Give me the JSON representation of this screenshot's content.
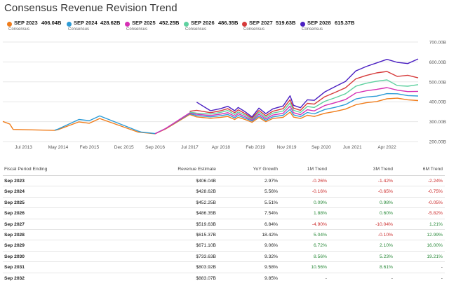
{
  "title": "Consensus Revenue Revision Trend",
  "legend": [
    {
      "name": "SEP 2023",
      "value": "406.04B",
      "sub": "Consensus",
      "color": "#f07c1a"
    },
    {
      "name": "SEP 2024",
      "value": "428.62B",
      "sub": "Consensus",
      "color": "#2d9bd6"
    },
    {
      "name": "SEP 2025",
      "value": "452.25B",
      "sub": "Consensus",
      "color": "#d62fb4"
    },
    {
      "name": "SEP 2026",
      "value": "486.35B",
      "sub": "Consensus",
      "color": "#5fd1a0"
    },
    {
      "name": "SEP 2027",
      "value": "519.63B",
      "sub": "Consensus",
      "color": "#d63a3a"
    },
    {
      "name": "SEP 2028",
      "value": "615.37B",
      "sub": "Consensus",
      "color": "#4a1fc2"
    }
  ],
  "chart_data": {
    "type": "line",
    "title": "Consensus Revenue Revision Trend",
    "xlabel": "",
    "ylabel": "",
    "x_ticks": [
      "Jul 2013",
      "May 2014",
      "Feb 2015",
      "Dec 2015",
      "Sep 2016",
      "Jul 2017",
      "Apr 2018",
      "Feb 2019",
      "Nov 2019",
      "Sep 2020",
      "Jun 2021",
      "Apr 2022"
    ],
    "y_ticks": [
      "200.00B",
      "300.00B",
      "400.00B",
      "500.00B",
      "600.00B",
      "700.00B"
    ],
    "ylim": [
      200,
      700
    ],
    "xlim": [
      "2013-01",
      "2023-01"
    ],
    "y_unit": "B",
    "grid": true,
    "legend_position": "top",
    "series": [
      {
        "name": "SEP 2023",
        "color": "#f07c1a",
        "points": [
          [
            "2013-01",
            301
          ],
          [
            "2013-03",
            288
          ],
          [
            "2013-04",
            261
          ],
          [
            "2014-04",
            256
          ],
          [
            "2014-05",
            260
          ],
          [
            "2014-11",
            299
          ],
          [
            "2015-02",
            292
          ],
          [
            "2015-05",
            316
          ],
          [
            "2016-04",
            248
          ],
          [
            "2016-05",
            246
          ],
          [
            "2016-09",
            239
          ],
          [
            "2016-12",
            263
          ],
          [
            "2017-07",
            336
          ],
          [
            "2017-09",
            324
          ],
          [
            "2018-01",
            317
          ],
          [
            "2018-04",
            322
          ],
          [
            "2018-06",
            326
          ],
          [
            "2018-08",
            311
          ],
          [
            "2018-09",
            322
          ],
          [
            "2018-11",
            311
          ],
          [
            "2019-01",
            297
          ],
          [
            "2019-03",
            321
          ],
          [
            "2019-05",
            300
          ],
          [
            "2019-07",
            316
          ],
          [
            "2019-10",
            322
          ],
          [
            "2019-12",
            348
          ],
          [
            "2020-01",
            323
          ],
          [
            "2020-03",
            316
          ],
          [
            "2020-05",
            332
          ],
          [
            "2020-07",
            326
          ],
          [
            "2020-10",
            342
          ],
          [
            "2021-01",
            351
          ],
          [
            "2021-04",
            363
          ],
          [
            "2021-07",
            385
          ],
          [
            "2021-10",
            395
          ],
          [
            "2022-01",
            401
          ],
          [
            "2022-04",
            415
          ],
          [
            "2022-07",
            418
          ],
          [
            "2022-10",
            410
          ],
          [
            "2023-01",
            406
          ]
        ]
      },
      {
        "name": "SEP 2024",
        "color": "#2d9bd6",
        "points": [
          [
            "2014-04",
            257
          ],
          [
            "2014-05",
            263
          ],
          [
            "2014-11",
            311
          ],
          [
            "2015-02",
            305
          ],
          [
            "2015-05",
            329
          ],
          [
            "2016-04",
            253
          ],
          [
            "2016-05",
            248
          ],
          [
            "2016-09",
            240
          ],
          [
            "2016-12",
            265
          ],
          [
            "2017-07",
            340
          ],
          [
            "2017-09",
            331
          ],
          [
            "2018-01",
            324
          ],
          [
            "2018-04",
            330
          ],
          [
            "2018-06",
            336
          ],
          [
            "2018-08",
            319
          ],
          [
            "2018-09",
            331
          ],
          [
            "2018-11",
            318
          ],
          [
            "2019-01",
            303
          ],
          [
            "2019-03",
            329
          ],
          [
            "2019-05",
            307
          ],
          [
            "2019-07",
            324
          ],
          [
            "2019-10",
            332
          ],
          [
            "2019-12",
            362
          ],
          [
            "2020-01",
            334
          ],
          [
            "2020-03",
            325
          ],
          [
            "2020-05",
            346
          ],
          [
            "2020-07",
            339
          ],
          [
            "2020-10",
            361
          ],
          [
            "2021-01",
            372
          ],
          [
            "2021-04",
            386
          ],
          [
            "2021-07",
            414
          ],
          [
            "2021-10",
            424
          ],
          [
            "2022-01",
            428
          ],
          [
            "2022-04",
            441
          ],
          [
            "2022-07",
            440
          ],
          [
            "2022-10",
            431
          ],
          [
            "2023-01",
            429
          ]
        ]
      },
      {
        "name": "SEP 2025",
        "color": "#d62fb4",
        "points": [
          [
            "2016-09",
            239
          ],
          [
            "2016-12",
            265
          ],
          [
            "2017-07",
            344
          ],
          [
            "2017-09",
            337
          ],
          [
            "2018-01",
            331
          ],
          [
            "2018-04",
            338
          ],
          [
            "2018-06",
            345
          ],
          [
            "2018-08",
            327
          ],
          [
            "2018-09",
            340
          ],
          [
            "2018-11",
            325
          ],
          [
            "2019-01",
            308
          ],
          [
            "2019-03",
            338
          ],
          [
            "2019-05",
            314
          ],
          [
            "2019-07",
            333
          ],
          [
            "2019-10",
            342
          ],
          [
            "2019-12",
            378
          ],
          [
            "2020-01",
            345
          ],
          [
            "2020-03",
            335
          ],
          [
            "2020-05",
            360
          ],
          [
            "2020-07",
            354
          ],
          [
            "2020-10",
            381
          ],
          [
            "2021-01",
            395
          ],
          [
            "2021-04",
            411
          ],
          [
            "2021-07",
            444
          ],
          [
            "2021-10",
            455
          ],
          [
            "2022-01",
            462
          ],
          [
            "2022-04",
            471
          ],
          [
            "2022-07",
            458
          ],
          [
            "2022-10",
            451
          ],
          [
            "2023-01",
            452
          ]
        ]
      },
      {
        "name": "SEP 2026",
        "color": "#5fd1a0",
        "points": [
          [
            "2017-07",
            348
          ],
          [
            "2017-09",
            343
          ],
          [
            "2018-01",
            338
          ],
          [
            "2018-04",
            347
          ],
          [
            "2018-06",
            356
          ],
          [
            "2018-08",
            336
          ],
          [
            "2018-09",
            349
          ],
          [
            "2018-11",
            333
          ],
          [
            "2019-01",
            313
          ],
          [
            "2019-03",
            347
          ],
          [
            "2019-05",
            322
          ],
          [
            "2019-07",
            343
          ],
          [
            "2019-10",
            353
          ],
          [
            "2019-12",
            394
          ],
          [
            "2020-01",
            357
          ],
          [
            "2020-03",
            346
          ],
          [
            "2020-05",
            376
          ],
          [
            "2020-07",
            371
          ],
          [
            "2020-10",
            402
          ],
          [
            "2021-01",
            420
          ],
          [
            "2021-04",
            440
          ],
          [
            "2021-07",
            478
          ],
          [
            "2021-10",
            493
          ],
          [
            "2022-01",
            503
          ],
          [
            "2022-04",
            510
          ],
          [
            "2022-07",
            481
          ],
          [
            "2022-10",
            478
          ],
          [
            "2023-01",
            486
          ]
        ]
      },
      {
        "name": "SEP 2027",
        "color": "#d63a3a",
        "points": [
          [
            "2017-07",
            352
          ],
          [
            "2017-09",
            357
          ],
          [
            "2018-01",
            345
          ],
          [
            "2018-04",
            355
          ],
          [
            "2018-06",
            365
          ],
          [
            "2018-08",
            345
          ],
          [
            "2018-09",
            359
          ],
          [
            "2018-11",
            341
          ],
          [
            "2019-01",
            318
          ],
          [
            "2019-03",
            356
          ],
          [
            "2019-05",
            330
          ],
          [
            "2019-07",
            352
          ],
          [
            "2019-10",
            365
          ],
          [
            "2019-12",
            410
          ],
          [
            "2020-01",
            368
          ],
          [
            "2020-03",
            357
          ],
          [
            "2020-05",
            392
          ],
          [
            "2020-07",
            388
          ],
          [
            "2020-10",
            425
          ],
          [
            "2021-01",
            447
          ],
          [
            "2021-04",
            470
          ],
          [
            "2021-07",
            515
          ],
          [
            "2021-10",
            532
          ],
          [
            "2022-01",
            545
          ],
          [
            "2022-04",
            552
          ],
          [
            "2022-07",
            527
          ],
          [
            "2022-10",
            533
          ],
          [
            "2023-01",
            520
          ]
        ]
      },
      {
        "name": "SEP 2028",
        "color": "#4a1fc2",
        "points": [
          [
            "2017-09",
            398
          ],
          [
            "2018-01",
            355
          ],
          [
            "2018-04",
            366
          ],
          [
            "2018-06",
            377
          ],
          [
            "2018-08",
            355
          ],
          [
            "2018-09",
            371
          ],
          [
            "2018-11",
            350
          ],
          [
            "2019-01",
            324
          ],
          [
            "2019-03",
            368
          ],
          [
            "2019-05",
            340
          ],
          [
            "2019-07",
            364
          ],
          [
            "2019-10",
            379
          ],
          [
            "2019-12",
            430
          ],
          [
            "2020-01",
            382
          ],
          [
            "2020-03",
            370
          ],
          [
            "2020-05",
            410
          ],
          [
            "2020-07",
            407
          ],
          [
            "2020-10",
            449
          ],
          [
            "2021-01",
            476
          ],
          [
            "2021-04",
            502
          ],
          [
            "2021-07",
            555
          ],
          [
            "2021-10",
            577
          ],
          [
            "2022-01",
            595
          ],
          [
            "2022-04",
            613
          ],
          [
            "2022-07",
            598
          ],
          [
            "2022-10",
            592
          ],
          [
            "2023-01",
            615
          ]
        ]
      }
    ]
  },
  "table": {
    "headers": [
      "Fiscal Period Ending",
      "Revenue Estimate",
      "YoY Growth",
      "1M Trend",
      "3M Trend",
      "6M Trend"
    ],
    "rows": [
      [
        "Sep 2023",
        "$406.04B",
        "2.97%",
        "-0.26%",
        "-1.42%",
        "-2.24%"
      ],
      [
        "Sep 2024",
        "$428.62B",
        "5.56%",
        "-0.16%",
        "-0.65%",
        "-0.75%"
      ],
      [
        "Sep 2025",
        "$452.25B",
        "5.51%",
        "0.09%",
        "0.98%",
        "-0.05%"
      ],
      [
        "Sep 2026",
        "$486.35B",
        "7.54%",
        "1.88%",
        "0.60%",
        "-5.82%"
      ],
      [
        "Sep 2027",
        "$519.63B",
        "6.84%",
        "-4.90%",
        "-10.04%",
        "1.21%"
      ],
      [
        "Sep 2028",
        "$615.37B",
        "18.42%",
        "5.04%",
        "-0.10%",
        "12.99%"
      ],
      [
        "Sep 2029",
        "$671.10B",
        "9.06%",
        "6.72%",
        "2.10%",
        "16.00%"
      ],
      [
        "Sep 2030",
        "$733.63B",
        "9.32%",
        "8.56%",
        "5.23%",
        "19.21%"
      ],
      [
        "Sep 2031",
        "$803.92B",
        "9.58%",
        "10.56%",
        "8.61%",
        "-"
      ],
      [
        "Sep 2032",
        "$883.07B",
        "9.85%",
        "-",
        "-",
        "-"
      ]
    ]
  }
}
